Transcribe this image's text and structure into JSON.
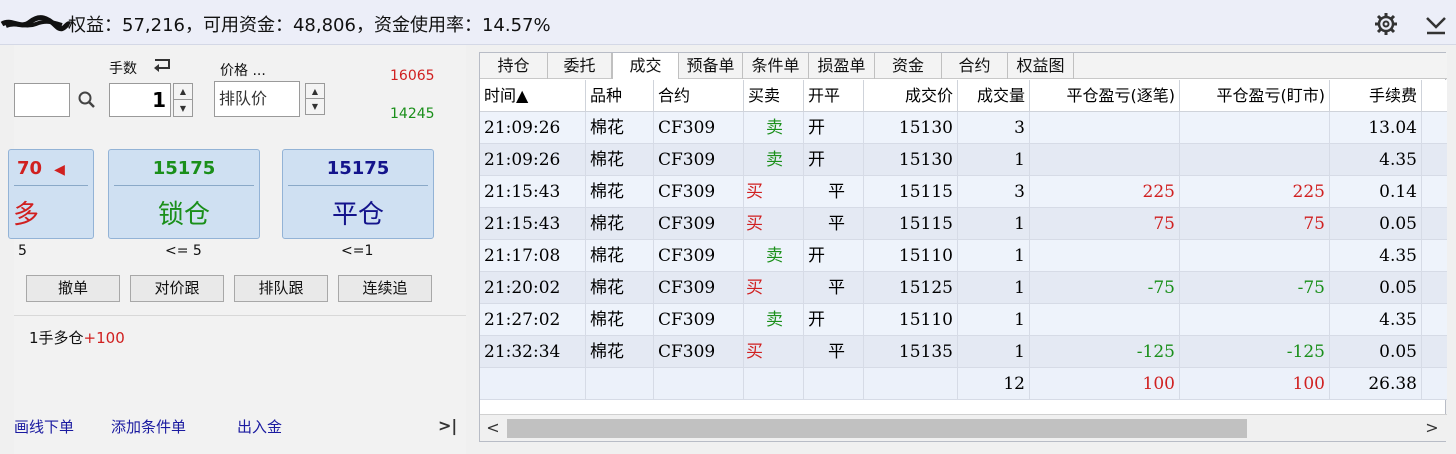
{
  "top": {
    "summary": "权益：57,216，可用资金：48,806，资金使用率：14.57%",
    "gear_icon": "gear-icon",
    "collapse_icon": "chevron-down-icon"
  },
  "order": {
    "qty_label": "手数",
    "price_label": "价格 ...",
    "qty_value": "1",
    "price_value": "排队价",
    "upper_price": "16065",
    "lower_price": "14245",
    "long_btn": {
      "price": "70",
      "action": "多",
      "limit": "5"
    },
    "lock_btn": {
      "price": "15175",
      "action": "锁仓",
      "limit": "<= 5"
    },
    "close_btn": {
      "price": "15175",
      "action": "平仓",
      "limit": "<=1"
    },
    "actions": [
      "撤单",
      "对价跟",
      "排队跟",
      "连续追"
    ],
    "status_prefix": "1手多仓",
    "status_value": "+100",
    "links": [
      "画线下单",
      "添加条件单",
      "出入金"
    ],
    "colors": {
      "red": "#d02020",
      "green": "#1a8f1a",
      "blue": "#14148c"
    }
  },
  "tabs": [
    "持仓",
    "委托",
    "成交",
    "预备单",
    "条件单",
    "损盈单",
    "资金",
    "合约",
    "权益图"
  ],
  "active_tab": "成交",
  "table": {
    "headers": [
      "时间▲",
      "品种",
      "合约",
      "买卖",
      "开平",
      "成交价",
      "成交量",
      "平仓盈亏(逐笔)",
      "平仓盈亏(盯市)",
      "手续费"
    ],
    "rows": [
      [
        "21:09:26",
        "棉花",
        "CF309",
        "卖",
        "开",
        "15130",
        "3",
        "",
        "",
        "13.04"
      ],
      [
        "21:09:26",
        "棉花",
        "CF309",
        "卖",
        "开",
        "15130",
        "1",
        "",
        "",
        "4.35"
      ],
      [
        "21:15:43",
        "棉花",
        "CF309",
        "买",
        "平",
        "15115",
        "3",
        "225",
        "225",
        "0.14"
      ],
      [
        "21:15:43",
        "棉花",
        "CF309",
        "买",
        "平",
        "15115",
        "1",
        "75",
        "75",
        "0.05"
      ],
      [
        "21:17:08",
        "棉花",
        "CF309",
        "卖",
        "开",
        "15110",
        "1",
        "",
        "",
        "4.35"
      ],
      [
        "21:20:02",
        "棉花",
        "CF309",
        "买",
        "平",
        "15125",
        "1",
        "-75",
        "-75",
        "0.05"
      ],
      [
        "21:27:02",
        "棉花",
        "CF309",
        "卖",
        "开",
        "15110",
        "1",
        "",
        "",
        "4.35"
      ],
      [
        "21:32:34",
        "棉花",
        "CF309",
        "买",
        "平",
        "15135",
        "1",
        "-125",
        "-125",
        "0.05"
      ]
    ],
    "totals": [
      "",
      "",
      "",
      "",
      "",
      "",
      "12",
      "100",
      "100",
      "26.38"
    ]
  }
}
